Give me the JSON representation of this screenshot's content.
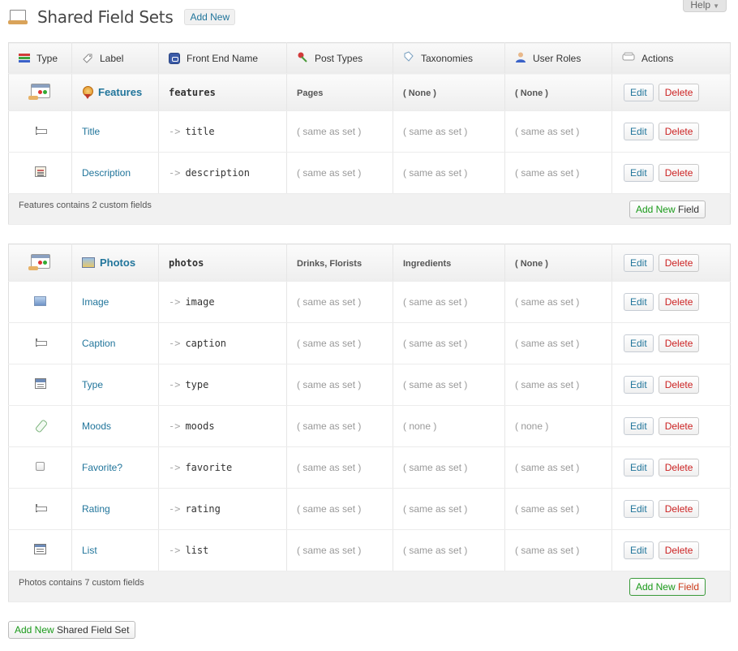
{
  "header": {
    "title": "Shared Field Sets",
    "add_new_label": "Add New",
    "help_label": "Help",
    "help_arrow": "▼"
  },
  "columns": {
    "type": "Type",
    "label": "Label",
    "front_end_name": "Front End Name",
    "post_types": "Post Types",
    "taxonomies": "Taxonomies",
    "user_roles": "User Roles",
    "actions": "Actions"
  },
  "buttons": {
    "edit": "Edit",
    "delete": "Delete",
    "add_new_part": "Add New",
    "field_part": "Field",
    "shared_field_set_part": "Shared Field Set"
  },
  "arrow": "->",
  "sets": [
    {
      "label": "Features",
      "front_end_name": "features",
      "post_types": "Pages",
      "taxonomies": "( None )",
      "user_roles": "( None )",
      "footer": "Features contains 2 custom fields",
      "fields": [
        {
          "label": "Title",
          "front_end_name": "title",
          "icon": "text-field-icon",
          "post_types": "( same as set )",
          "taxonomies": "( same as set )",
          "user_roles": "( same as set )"
        },
        {
          "label": "Description",
          "front_end_name": "description",
          "icon": "textarea-field-icon",
          "post_types": "( same as set )",
          "taxonomies": "( same as set )",
          "user_roles": "( same as set )"
        }
      ]
    },
    {
      "label": "Photos",
      "front_end_name": "photos",
      "post_types": "Drinks, Florists",
      "taxonomies": "Ingredients",
      "user_roles": "( None )",
      "footer": "Photos contains 7 custom fields",
      "fields": [
        {
          "label": "Image",
          "front_end_name": "image",
          "icon": "image-field-icon",
          "post_types": "( same as set )",
          "taxonomies": "( same as set )",
          "user_roles": "( same as set )"
        },
        {
          "label": "Caption",
          "front_end_name": "caption",
          "icon": "text-field-icon",
          "post_types": "( same as set )",
          "taxonomies": "( same as set )",
          "user_roles": "( same as set )"
        },
        {
          "label": "Type",
          "front_end_name": "type",
          "icon": "select-field-icon",
          "post_types": "( same as set )",
          "taxonomies": "( same as set )",
          "user_roles": "( same as set )"
        },
        {
          "label": "Moods",
          "front_end_name": "moods",
          "icon": "tag-field-icon",
          "post_types": "( same as set )",
          "taxonomies": "( none )",
          "user_roles": "( none )"
        },
        {
          "label": "Favorite?",
          "front_end_name": "favorite",
          "icon": "checkbox-field-icon",
          "post_types": "( same as set )",
          "taxonomies": "( same as set )",
          "user_roles": "( same as set )"
        },
        {
          "label": "Rating",
          "front_end_name": "rating",
          "icon": "text-field-icon",
          "post_types": "( same as set )",
          "taxonomies": "( same as set )",
          "user_roles": "( same as set )"
        },
        {
          "label": "List",
          "front_end_name": "list",
          "icon": "list-field-icon",
          "post_types": "( same as set )",
          "taxonomies": "( same as set )",
          "user_roles": "( same as set )"
        }
      ]
    }
  ]
}
